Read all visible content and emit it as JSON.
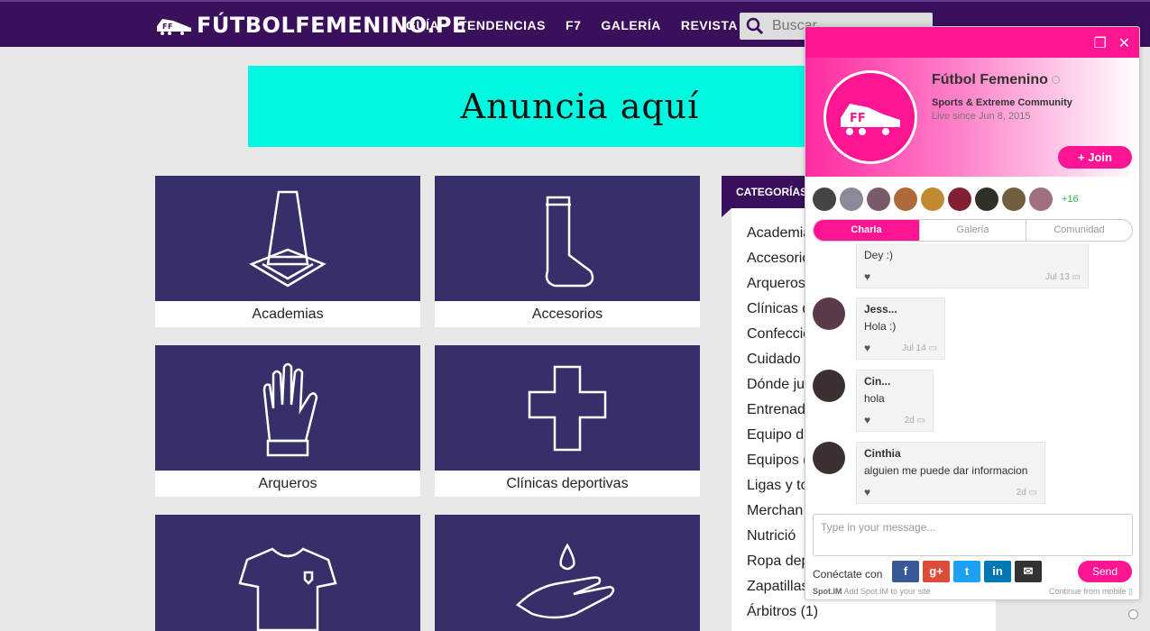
{
  "header": {
    "logo_text": "FÚTBOLFEMENINO.PE",
    "nav": [
      "GUÍA",
      "TENDENCIAS",
      "F7",
      "GALERÍA",
      "REVISTA"
    ],
    "search_placeholder": "Buscar"
  },
  "banner": {
    "text": "Anuncia aquí"
  },
  "cards": [
    {
      "label": "Academias",
      "icon": "cone-icon"
    },
    {
      "label": "Accesorios",
      "icon": "sock-icon"
    },
    {
      "label": "Arqueros",
      "icon": "glove-icon"
    },
    {
      "label": "Clínicas deportivas",
      "icon": "cross-icon"
    },
    {
      "label": "",
      "icon": "jersey-icon"
    },
    {
      "label": "",
      "icon": "hand-drop-icon"
    }
  ],
  "categories": {
    "title": "CATEGORÍAS",
    "items": [
      "Academias",
      "Accesorios",
      "Arqueros",
      "Clínicas d",
      "Confeccio",
      "Cuidado",
      "Dónde ju",
      "Entrenad",
      "Equipo d",
      "Equipos (",
      "Ligas y to",
      "Merchan",
      "Nutrició",
      "Ropa dep",
      "Zapatillas",
      "Árbitros (1)"
    ]
  },
  "widget": {
    "colors": {
      "accent": "#ff1493"
    },
    "community_name": "Fútbol Femenino",
    "community_type": "Sports & Extreme Community",
    "live_since": "Live since Jun 8, 2015",
    "join_label": "+ Join",
    "members_more": "+16",
    "tabs": [
      "Charla",
      "Galería",
      "Comunidad"
    ],
    "messages": [
      {
        "author": "",
        "text": "Dey :)",
        "time": "Jul 13"
      },
      {
        "author": "Jess...",
        "text": "Hola :)",
        "time": "Jul 14"
      },
      {
        "author": "Cin...",
        "text": "hola",
        "time": "2d"
      },
      {
        "author": "Cinthia",
        "text": "alguien me puede dar informacion",
        "time": "2d"
      }
    ],
    "input_placeholder": "Type in your message...",
    "connect_label": "Conéctate con",
    "social": [
      "f",
      "g+",
      "t",
      "in",
      "✉"
    ],
    "send_label": "Send",
    "footer_left": "Add Spot.IM to your site",
    "footer_right": "Continue from mobile"
  }
}
